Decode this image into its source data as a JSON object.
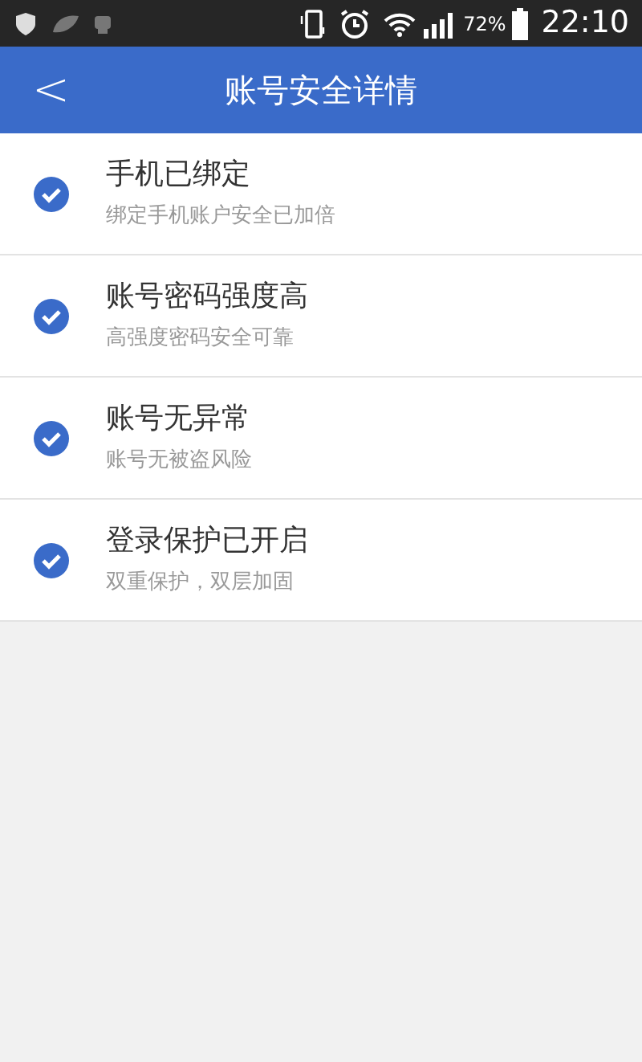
{
  "status_bar": {
    "battery_percent": "72%",
    "time": "22:10"
  },
  "header": {
    "back": "<",
    "title": "账号安全详情"
  },
  "items": [
    {
      "title": "手机已绑定",
      "subtitle": "绑定手机账户安全已加倍",
      "checked": true
    },
    {
      "title": "账号密码强度高",
      "subtitle": "高强度密码安全可靠",
      "checked": true
    },
    {
      "title": "账号无异常",
      "subtitle": "账号无被盗风险",
      "checked": true
    },
    {
      "title": "登录保护已开启",
      "subtitle": "双重保护，双层加固",
      "checked": true
    }
  ]
}
